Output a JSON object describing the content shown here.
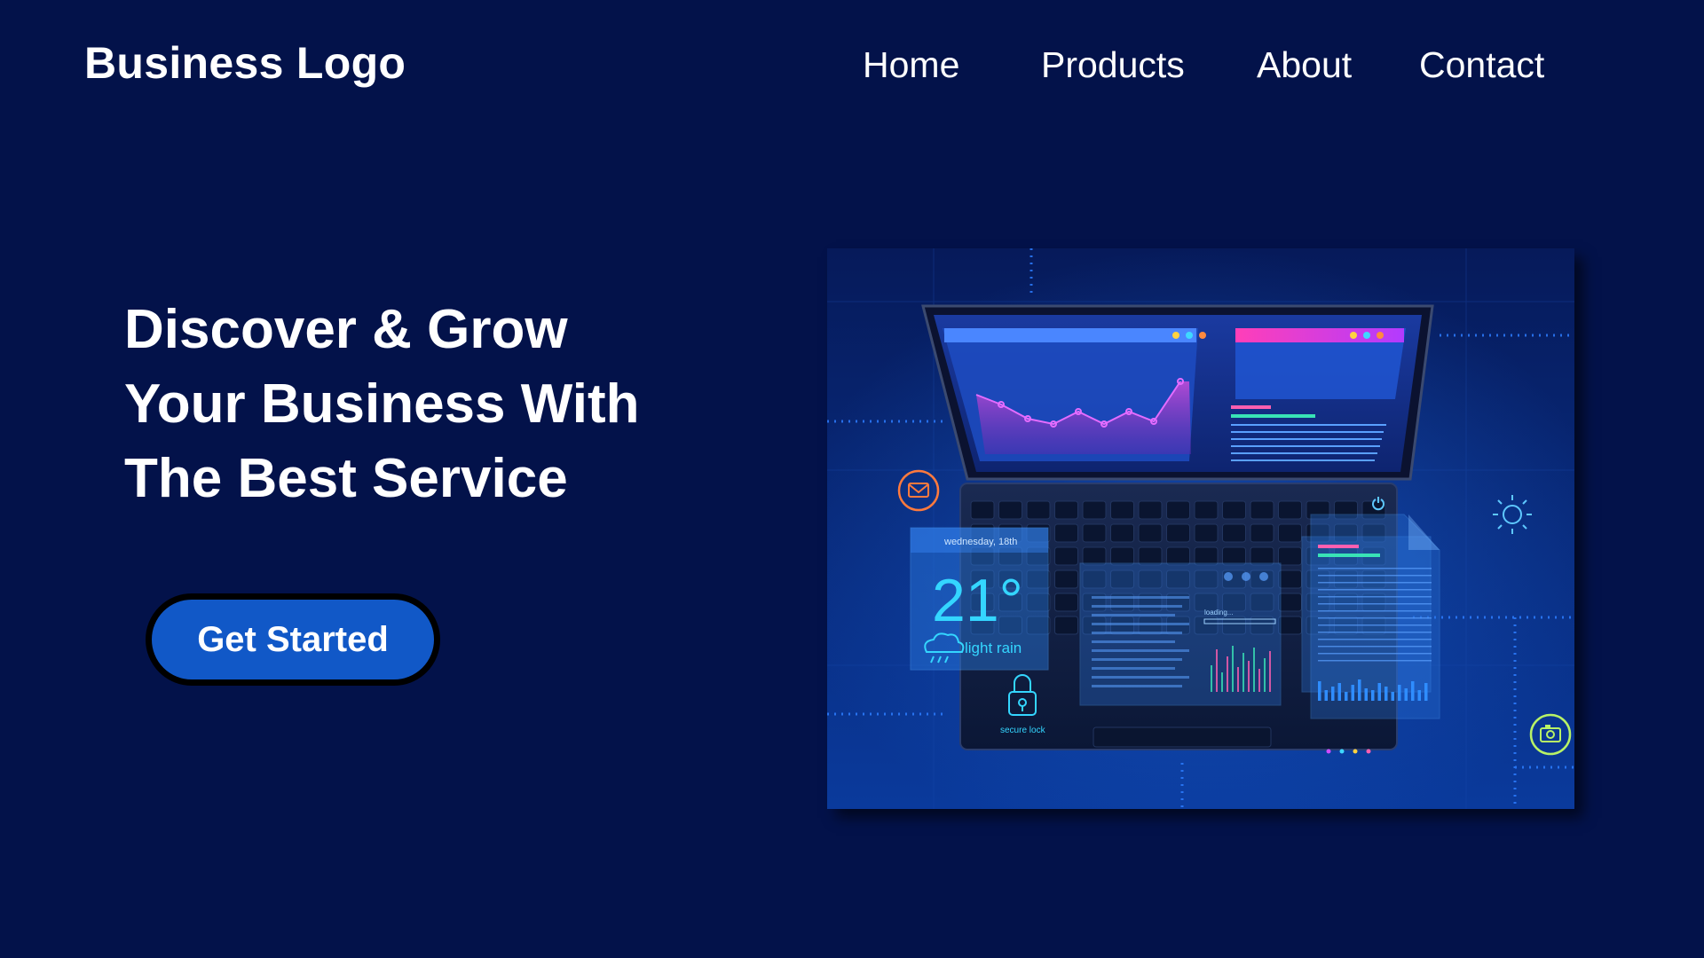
{
  "header": {
    "logo": "Business Logo",
    "nav": [
      "Home",
      "Products",
      "About",
      "Contact"
    ]
  },
  "hero": {
    "title_lines": [
      "Discover & Grow",
      "Your Business With",
      "The Best Service"
    ],
    "cta_label": "Get Started"
  },
  "illustration": {
    "weather_date": "wednesday, 18th",
    "temperature": "21°",
    "weather_condition": "light rain",
    "lock_label": "secure lock",
    "loading_label": "loading...",
    "icons": [
      "laptop-icon",
      "mail-icon",
      "sun-icon",
      "camera-icon",
      "lock-icon",
      "cloud-rain-icon",
      "power-icon"
    ]
  },
  "colors": {
    "background": "#03124a",
    "button": "#1158c7",
    "button_border": "#000000",
    "text": "#ffffff"
  }
}
